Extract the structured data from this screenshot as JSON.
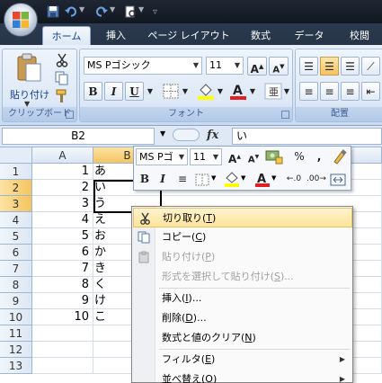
{
  "ribbon": {
    "tabs": [
      "ホーム",
      "挿入",
      "ページ レイアウト",
      "数式",
      "データ",
      "校閲"
    ],
    "active_tab": "ホーム",
    "clipboard": {
      "paste_label": "貼り付け",
      "group_label": "クリップボード"
    },
    "font": {
      "name": "MS Pゴシック",
      "size": "11",
      "group_label": "フォント",
      "bold": "B",
      "italic": "I",
      "underline": "U"
    },
    "alignment": {
      "group_label": "配置"
    }
  },
  "formula_bar": {
    "name_box": "B2",
    "fx": "fx",
    "value": "い"
  },
  "columns": [
    "A",
    "B"
  ],
  "rows": [
    {
      "n": "1",
      "a": "1",
      "b": "あ"
    },
    {
      "n": "2",
      "a": "2",
      "b": "い"
    },
    {
      "n": "3",
      "a": "3",
      "b": "う"
    },
    {
      "n": "4",
      "a": "4",
      "b": "え"
    },
    {
      "n": "5",
      "a": "5",
      "b": "お"
    },
    {
      "n": "6",
      "a": "6",
      "b": "か"
    },
    {
      "n": "7",
      "a": "7",
      "b": "き"
    },
    {
      "n": "8",
      "a": "8",
      "b": "く"
    },
    {
      "n": "9",
      "a": "9",
      "b": "け"
    },
    {
      "n": "10",
      "a": "10",
      "b": "こ"
    },
    {
      "n": "11",
      "a": "",
      "b": ""
    },
    {
      "n": "12",
      "a": "",
      "b": ""
    },
    {
      "n": "13",
      "a": "",
      "b": ""
    }
  ],
  "mini_toolbar": {
    "font_name": "MS Pゴ",
    "font_size": "11",
    "bold": "B",
    "italic": "I",
    "percent": "%",
    "comma": ","
  },
  "context_menu": {
    "cut": "切り取り",
    "cut_key": "T",
    "copy": "コピー",
    "copy_key": "C",
    "paste": "貼り付け",
    "paste_key": "P",
    "paste_special": "形式を選択して貼り付け",
    "paste_special_key": "S",
    "insert": "挿入",
    "insert_key": "I",
    "delete": "削除",
    "delete_key": "D",
    "clear": "数式と値のクリア",
    "clear_key": "N",
    "filter": "フィルタ",
    "filter_key": "E",
    "sort": "並べ替え",
    "sort_key": "O",
    "ellipsis": "..."
  },
  "colors": {
    "accent": "#15428b",
    "selection": "#f5c45f",
    "ribbon": "#dde8f6"
  }
}
